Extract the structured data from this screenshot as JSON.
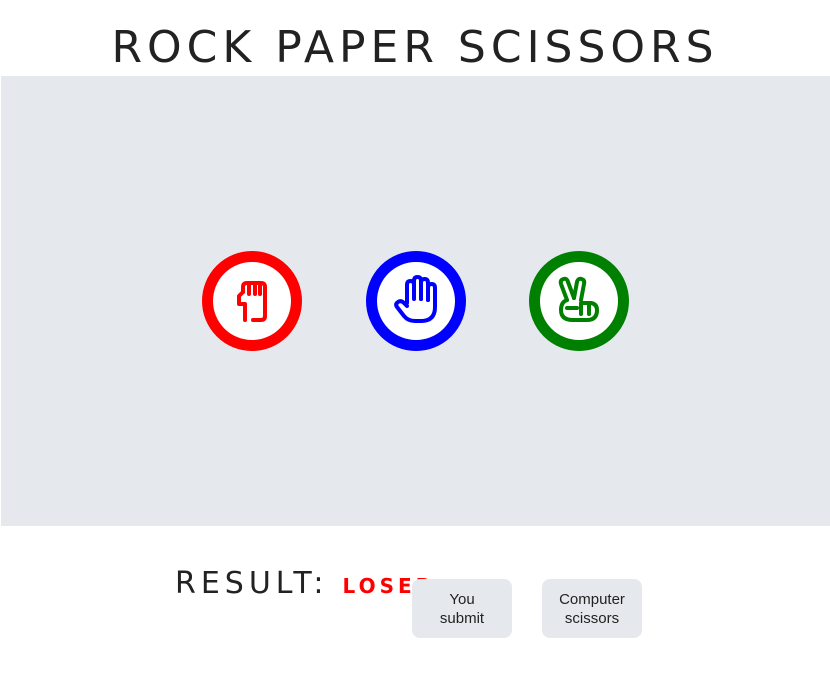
{
  "title": "ROCK PAPER SCISSORS",
  "choices": [
    {
      "name": "rock",
      "color": "#ff0000",
      "icon": "fist-icon"
    },
    {
      "name": "paper",
      "color": "#0000ff",
      "icon": "open-hand-icon"
    },
    {
      "name": "scissors",
      "color": "#008000",
      "icon": "victory-hand-icon"
    }
  ],
  "result": {
    "label": "RESULT:",
    "value": "LOSER",
    "value_color": "#ff0000"
  },
  "player": {
    "line1": "You",
    "line2": "submit"
  },
  "computer": {
    "line1": "Computer",
    "line2": "scissors"
  },
  "colors": {
    "board_bg": "#e5e9ee",
    "badge_bg": "#e5e9ee"
  }
}
